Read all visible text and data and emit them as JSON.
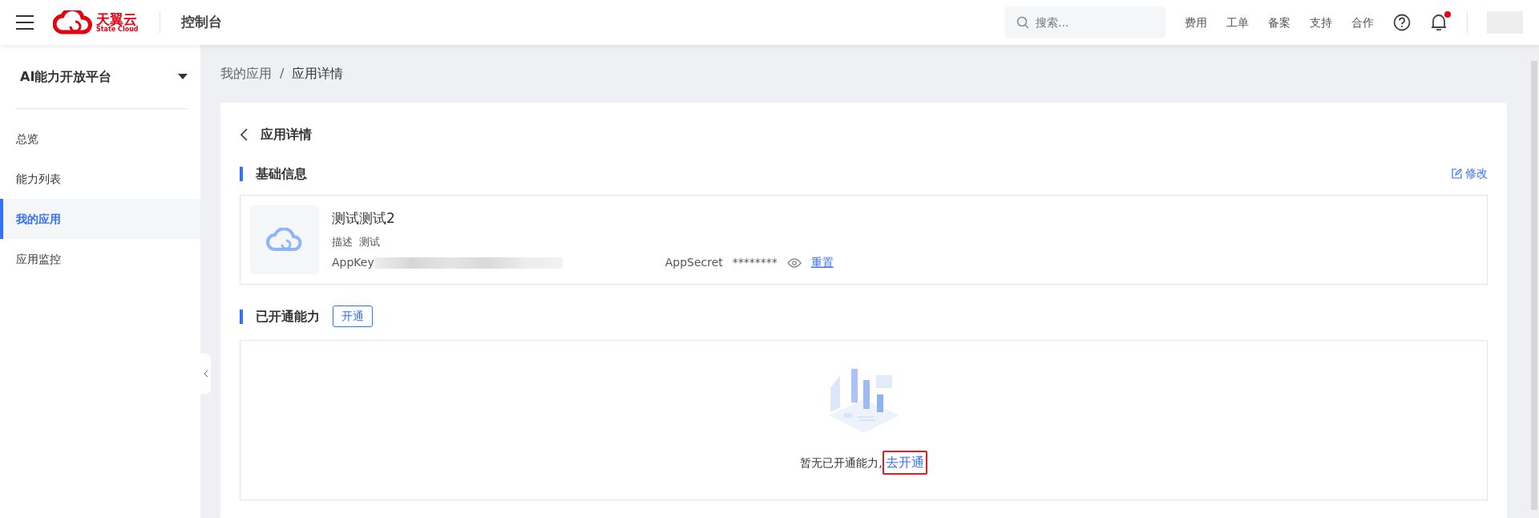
{
  "header": {
    "brand": {
      "name": "天翼云",
      "sub": "State Cloud"
    },
    "console": "控制台",
    "search": {
      "placeholder": "搜索..."
    },
    "links": [
      "费用",
      "工单",
      "备案",
      "支持",
      "合作"
    ],
    "notification_dot": true
  },
  "sidebar": {
    "title": "AI能力开放平台",
    "items": [
      {
        "label": "总览",
        "selected": false
      },
      {
        "label": "能力列表",
        "selected": false
      },
      {
        "label": "我的应用",
        "selected": true
      },
      {
        "label": "应用监控",
        "selected": false
      }
    ]
  },
  "breadcrumb_separator": "/",
  "breadcrumb": [
    {
      "label": "我的应用",
      "current": false
    },
    {
      "label": "应用详情",
      "current": true
    }
  ],
  "page_title": "应用详情",
  "basic": {
    "title": "基础信息",
    "edit": "修改",
    "app_name": "测试测试2",
    "desc_label": "描述",
    "desc_value": "测试",
    "appkey_label": "AppKey",
    "secret_label": "AppSecret",
    "secret_value": "********",
    "reset": "重置"
  },
  "abilities": {
    "title": "已开通能力",
    "open_button": "开通",
    "empty_text": "暂无已开通能力,",
    "empty_link": {
      "label": "去开通",
      "highlighted": true
    }
  }
}
